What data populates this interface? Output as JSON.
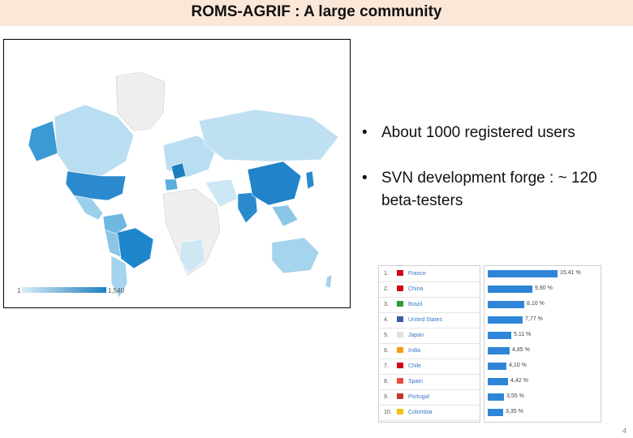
{
  "slide": {
    "title": "ROMS-AGRIF : A large community",
    "page_number": "4"
  },
  "map": {
    "legend_min": "1",
    "legend_max": "1,540",
    "colors": {
      "low": "#d6ecf7",
      "mid": "#8cc6e6",
      "high": "#1e7fc0",
      "none": "#eeeeee"
    }
  },
  "bullets": [
    "About 1000 registered users",
    "SVN development forge : ~ 120 beta-testers"
  ],
  "country_table": {
    "rows": [
      {
        "rank": "1.",
        "country": "France",
        "pct": "15,41 %",
        "value": 15.41,
        "flag_color": "#d0021b"
      },
      {
        "rank": "2.",
        "country": "China",
        "pct": "9,90 %",
        "value": 9.9,
        "flag_color": "#d0021b"
      },
      {
        "rank": "3.",
        "country": "Brazil",
        "pct": "8,10 %",
        "value": 8.1,
        "flag_color": "#2e9b3b"
      },
      {
        "rank": "4.",
        "country": "United States",
        "pct": "7,77 %",
        "value": 7.77,
        "flag_color": "#3b5ba5"
      },
      {
        "rank": "5.",
        "country": "Japan",
        "pct": "5,11 %",
        "value": 5.11,
        "flag_color": "#e0e0e0"
      },
      {
        "rank": "6.",
        "country": "India",
        "pct": "4,85 %",
        "value": 4.85,
        "flag_color": "#f39c12"
      },
      {
        "rank": "7.",
        "country": "Chile",
        "pct": "4,10 %",
        "value": 4.1,
        "flag_color": "#d0021b"
      },
      {
        "rank": "8.",
        "country": "Spain",
        "pct": "4,42 %",
        "value": 4.42,
        "flag_color": "#e74c3c"
      },
      {
        "rank": "9.",
        "country": "Portugal",
        "pct": "3,55 %",
        "value": 3.55,
        "flag_color": "#c0392b"
      },
      {
        "rank": "10.",
        "country": "Colombia",
        "pct": "3,35 %",
        "value": 3.35,
        "flag_color": "#f1c40f"
      }
    ]
  }
}
